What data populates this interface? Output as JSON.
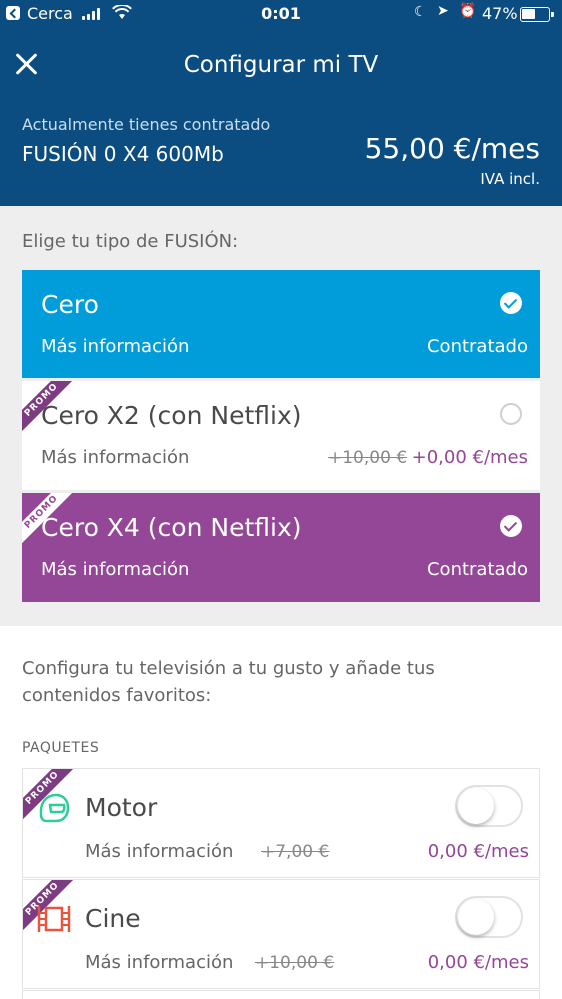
{
  "status_bar": {
    "carrier": "Cerca",
    "time": "0:01",
    "battery": "47%"
  },
  "header": {
    "title": "Configurar mi TV",
    "current_label": "Actualmente tienes contratado",
    "current_plan": "FUSIÓN 0 X4 600Mb",
    "current_price": "55,00 €/mes",
    "iva": "IVA incl."
  },
  "fusion": {
    "section_label": "Elige tu tipo de FUSIÓN:",
    "options": [
      {
        "name": "Cero",
        "info": "Más información",
        "status": "Contratado",
        "selected": true,
        "color": "#019ddb"
      },
      {
        "name": "Cero X2 (con Netflix)",
        "info": "Más información",
        "old_price": "+10,00 €",
        "price": "+0,00 €/mes",
        "promo": "PROMO",
        "selected": false
      },
      {
        "name": "Cero X4 (con Netflix)",
        "info": "Más información",
        "status": "Contratado",
        "promo": "PROMO",
        "selected": true,
        "color": "#944796"
      }
    ]
  },
  "config": {
    "text": "Configura tu televisión a tu gusto y añade tus contenidos favoritos:",
    "paquetes_label": "PAQUETES",
    "packages": [
      {
        "name": "Motor",
        "icon": "helmet-icon",
        "info": "Más información",
        "old_price": "+7,00 €",
        "price": "0,00 €/mes",
        "promo": "PROMO",
        "enabled": false
      },
      {
        "name": "Cine",
        "icon": "film-icon",
        "info": "Más información",
        "old_price": "+10,00 €",
        "price": "0,00 €/mes",
        "promo": "PROMO",
        "enabled": false
      }
    ]
  },
  "colors": {
    "header_bg": "#0b4d80",
    "cero_blue": "#019ddb",
    "promo_purple": "#944796",
    "motor_icon": "#2ecc9a",
    "cine_icon": "#e8553e"
  }
}
